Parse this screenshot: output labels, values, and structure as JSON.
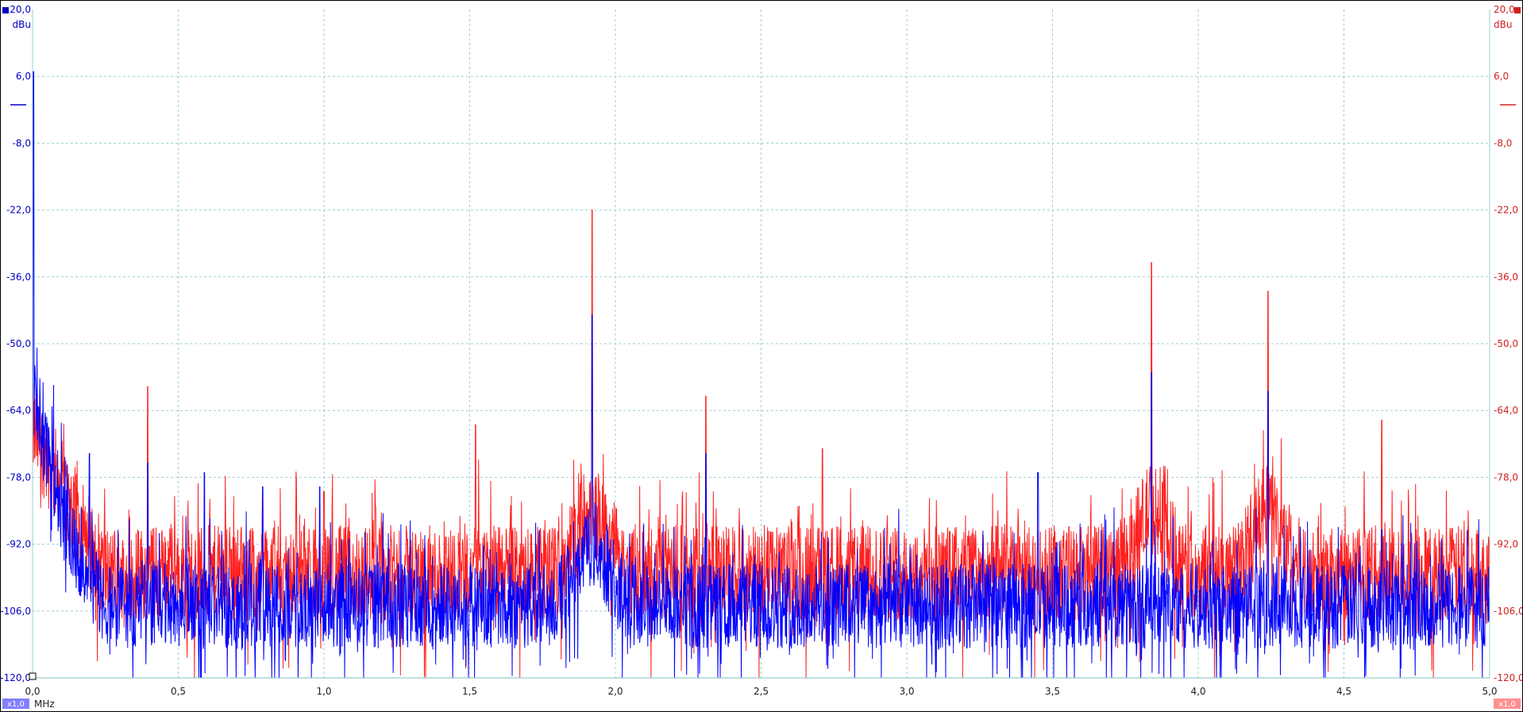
{
  "chart_data": {
    "type": "line",
    "title": "",
    "xlabel": "MHz",
    "ylabel": "dBu",
    "y_unit_left": "dBu",
    "y_unit_right": "dBu",
    "x_scale_left": "x1,0",
    "x_scale_right": "x1,0",
    "xlim": [
      0.0,
      5.0
    ],
    "ylim": [
      -120.0,
      20.0
    ],
    "x_ticks": [
      "0,0",
      "0,5",
      "1,0",
      "1,5",
      "2,0",
      "2,5",
      "3,0",
      "3,5",
      "4,0",
      "4,5",
      "5,0"
    ],
    "x_tick_values": [
      0.0,
      0.5,
      1.0,
      1.5,
      2.0,
      2.5,
      3.0,
      3.5,
      4.0,
      4.5,
      5.0
    ],
    "y_ticks": [
      "20,0",
      "6,0",
      "-8,0",
      "-22,0",
      "-36,0",
      "-50,0",
      "-64,0",
      "-78,0",
      "-92,0",
      "-106,0",
      "-120,0"
    ],
    "y_tick_values": [
      20,
      6,
      -8,
      -22,
      -36,
      -50,
      -64,
      -78,
      -92,
      -106,
      -120
    ],
    "grid": true,
    "series": [
      {
        "color": "#ff2020",
        "axis": "right",
        "noise_floor_db": -97,
        "noise_spread_db": 10,
        "peaks": [
          {
            "x": 1.92,
            "y": -22
          },
          {
            "x": 3.84,
            "y": -33
          },
          {
            "x": 4.24,
            "y": -39
          },
          {
            "x": 0.395,
            "y": -59
          },
          {
            "x": 2.31,
            "y": -61
          },
          {
            "x": 4.63,
            "y": -66
          },
          {
            "x": 1.52,
            "y": -67
          },
          {
            "x": 2.71,
            "y": -72
          },
          {
            "x": 0.79,
            "y": -80
          },
          {
            "x": 1.0,
            "y": -81
          }
        ]
      },
      {
        "color": "#0000ff",
        "axis": "left",
        "noise_floor_db": -104,
        "noise_spread_db": 9,
        "peaks": [
          {
            "x": 0.003,
            "y": 7
          },
          {
            "x": 1.92,
            "y": -44
          },
          {
            "x": 3.84,
            "y": -56
          },
          {
            "x": 4.24,
            "y": -60
          },
          {
            "x": 2.31,
            "y": -73
          },
          {
            "x": 0.195,
            "y": -73
          },
          {
            "x": 0.395,
            "y": -75
          },
          {
            "x": 0.59,
            "y": -77
          },
          {
            "x": 3.45,
            "y": -77
          },
          {
            "x": 0.79,
            "y": -80
          },
          {
            "x": 0.985,
            "y": -80
          },
          {
            "x": 4.63,
            "y": -89
          }
        ]
      }
    ]
  },
  "colors": {
    "left_axis": "#0000c8",
    "right_axis": "#d02020",
    "grid": "#9ccfd0",
    "blue_badge": "#8080ff",
    "red_badge": "#ff9090"
  }
}
